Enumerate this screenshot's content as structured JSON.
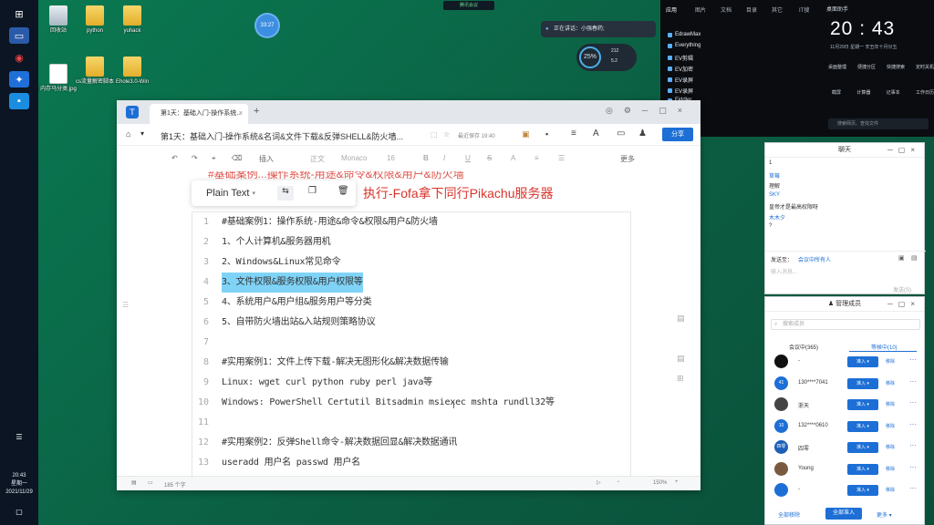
{
  "desktop": {
    "icons": [
      {
        "label": "回收站",
        "kind": "recycle"
      },
      {
        "label": "python",
        "kind": "folder"
      },
      {
        "label": "yuhack",
        "kind": "folder"
      },
      {
        "label": "内存马分类.jpg",
        "kind": "file"
      },
      {
        "label": "cs流量解密脚本",
        "kind": "folder"
      },
      {
        "label": "Ehole3.0-Win",
        "kind": "folder"
      }
    ],
    "circle_badge": "33:27",
    "meeting_top": "腾讯会议",
    "talking": "正在讲话：小强春药;",
    "net_percent": "25%",
    "net_up": "212",
    "net_down": "5.2"
  },
  "taskbar": {
    "time": "20:43",
    "weekday": "星期一",
    "date": "2021/11/29"
  },
  "apps_panel": {
    "tabs": [
      "应用",
      "图片",
      "文档",
      "目录",
      "其它",
      "IT搜"
    ],
    "items": [
      "EdrawMax",
      "Everything",
      "EV剪辑",
      "EV加密",
      "EV录屏",
      "EV录屏",
      "Fiddler"
    ]
  },
  "clock_panel": {
    "header": "桌面助手",
    "time": "20 : 43",
    "date": "11月29日  星期一  辛丑年十月廿五",
    "row1": [
      "桌面整理",
      "便捷分区",
      "快捷搜索",
      "定时关机"
    ],
    "row2": [
      "截屏",
      "计算器",
      "记事本",
      "工作日历"
    ],
    "search_placeholder": "搜索网页、查找文件"
  },
  "editor": {
    "tab_title": "第1天：基础入门-操作系统...",
    "doc_title": "第1天：基础入门-操作系统&名词&文件下载&反弹SHELL&防火墙...",
    "saved": "最近保存 19:40",
    "share": "分享",
    "insert": "插入",
    "style": "正文",
    "font": "Monaco",
    "size": "16",
    "more": "更多",
    "popup_label": "Plain Text",
    "heading_red": "执行-Fofa拿下同行Pikachu服务器",
    "heading_top": "#基础案例...操作系统-用途&命令&权限&用户&防火墙",
    "lines": [
      {
        "n": "1",
        "t": "#基础案例1：操作系统-用途&命令&权限&用户&防火墙"
      },
      {
        "n": "2",
        "t": "1、个人计算机&服务器用机"
      },
      {
        "n": "3",
        "t": "2、Windows&Linux常见命令"
      },
      {
        "n": "4",
        "t": "3、文件权限&服务权限&用户权限等"
      },
      {
        "n": "5",
        "t": "4、系统用户&用户组&服务用户等分类"
      },
      {
        "n": "6",
        "t": "5、自带防火墙出站&入站规则策略协议"
      },
      {
        "n": "7",
        "t": ""
      },
      {
        "n": "8",
        "t": "#实用案例1：文件上传下载-解决无图形化&解决数据传输"
      },
      {
        "n": "9",
        "t": "Linux: wget curl python ruby perl java等"
      },
      {
        "n": "10",
        "t": "Windows: PowerShell Certutil Bitsadmin msiexec mshta rundll32等"
      },
      {
        "n": "11",
        "t": ""
      },
      {
        "n": "12",
        "t": "#实用案例2：反弹Shell命令-解决数据回显&解决数据通讯"
      },
      {
        "n": "13",
        "t": "useradd 用户名 passwd 用户名"
      }
    ],
    "status_words": "185 个字",
    "zoom": "150%"
  },
  "chat": {
    "title": "聊天",
    "messages": [
      {
        "text": "1",
        "color": "#333"
      },
      {
        "text": "草莓",
        "color": "#1d6fd6"
      },
      {
        "text": "理解",
        "color": "#333"
      },
      {
        "text": "SKY",
        "color": "#1d6fd6"
      },
      {
        "text": "皇帝才是最高权限呀",
        "color": "#333"
      },
      {
        "text": "木木夕",
        "color": "#1d6fd6"
      },
      {
        "text": "?",
        "color": "#333"
      }
    ],
    "send_to_label": "发送至：",
    "send_to": "会议中所有人",
    "input_placeholder": "输入消息...",
    "send": "发送(S)"
  },
  "members": {
    "title": "管理成员",
    "search_placeholder": "搜索成员",
    "tab_in": "会议中(365)",
    "tab_wait": "等候中(10)",
    "rows": [
      {
        "name": "-",
        "avatar": "",
        "color": "#111"
      },
      {
        "name": "130****7041",
        "avatar": "41",
        "color": "#1d6fd6"
      },
      {
        "name": "浙天",
        "avatar": "",
        "color": "#444"
      },
      {
        "name": "132****0610",
        "avatar": "10",
        "color": "#1d6fd6"
      },
      {
        "name": "四零",
        "avatar": "四零",
        "color": "#1d5fb8"
      },
      {
        "name": "Young",
        "avatar": "",
        "color": "#7a5a3e"
      },
      {
        "name": "-",
        "avatar": "",
        "color": "#1d6fd6"
      }
    ],
    "admit": "准入",
    "remove": "移除",
    "remove_all": "全部移除",
    "admit_all": "全部准入",
    "more": "更多"
  }
}
